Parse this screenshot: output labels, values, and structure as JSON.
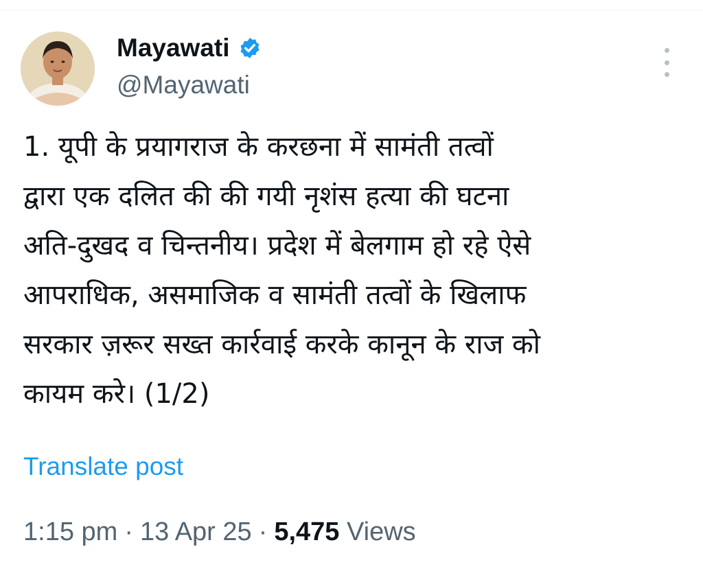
{
  "author": {
    "display_name": "Mayawati",
    "handle": "@Mayawati",
    "verified": true,
    "verified_badge_color": "#1d9bf0",
    "avatar_icon": "profile-photo"
  },
  "more_icon": "more-vertical-icon",
  "tweet": {
    "lines": [
      "1. यूपी के प्रयागराज के करछना में सामंती तत्वों",
      "द्वारा एक दलित की की गयी नृशंस हत्या की घटना",
      "अति-दुखद व चिन्तनीय। प्रदेश में बेलगाम हो रहे ऐसे",
      "आपराधिक, असमाजिक व सामंती तत्वों के खिलाफ",
      "सरकार ज़रूर सख्त कार्रवाई करके कानून के राज को",
      "कायम करे। (1/2)"
    ]
  },
  "translate_label": "Translate post",
  "meta": {
    "time": "1:15 pm",
    "separator": "·",
    "date": "13 Apr 25",
    "views_count": "5,475",
    "views_label": "Views"
  },
  "colors": {
    "link": "#1d9bf0",
    "secondary_text": "#536471",
    "primary_text": "#0f1419"
  }
}
